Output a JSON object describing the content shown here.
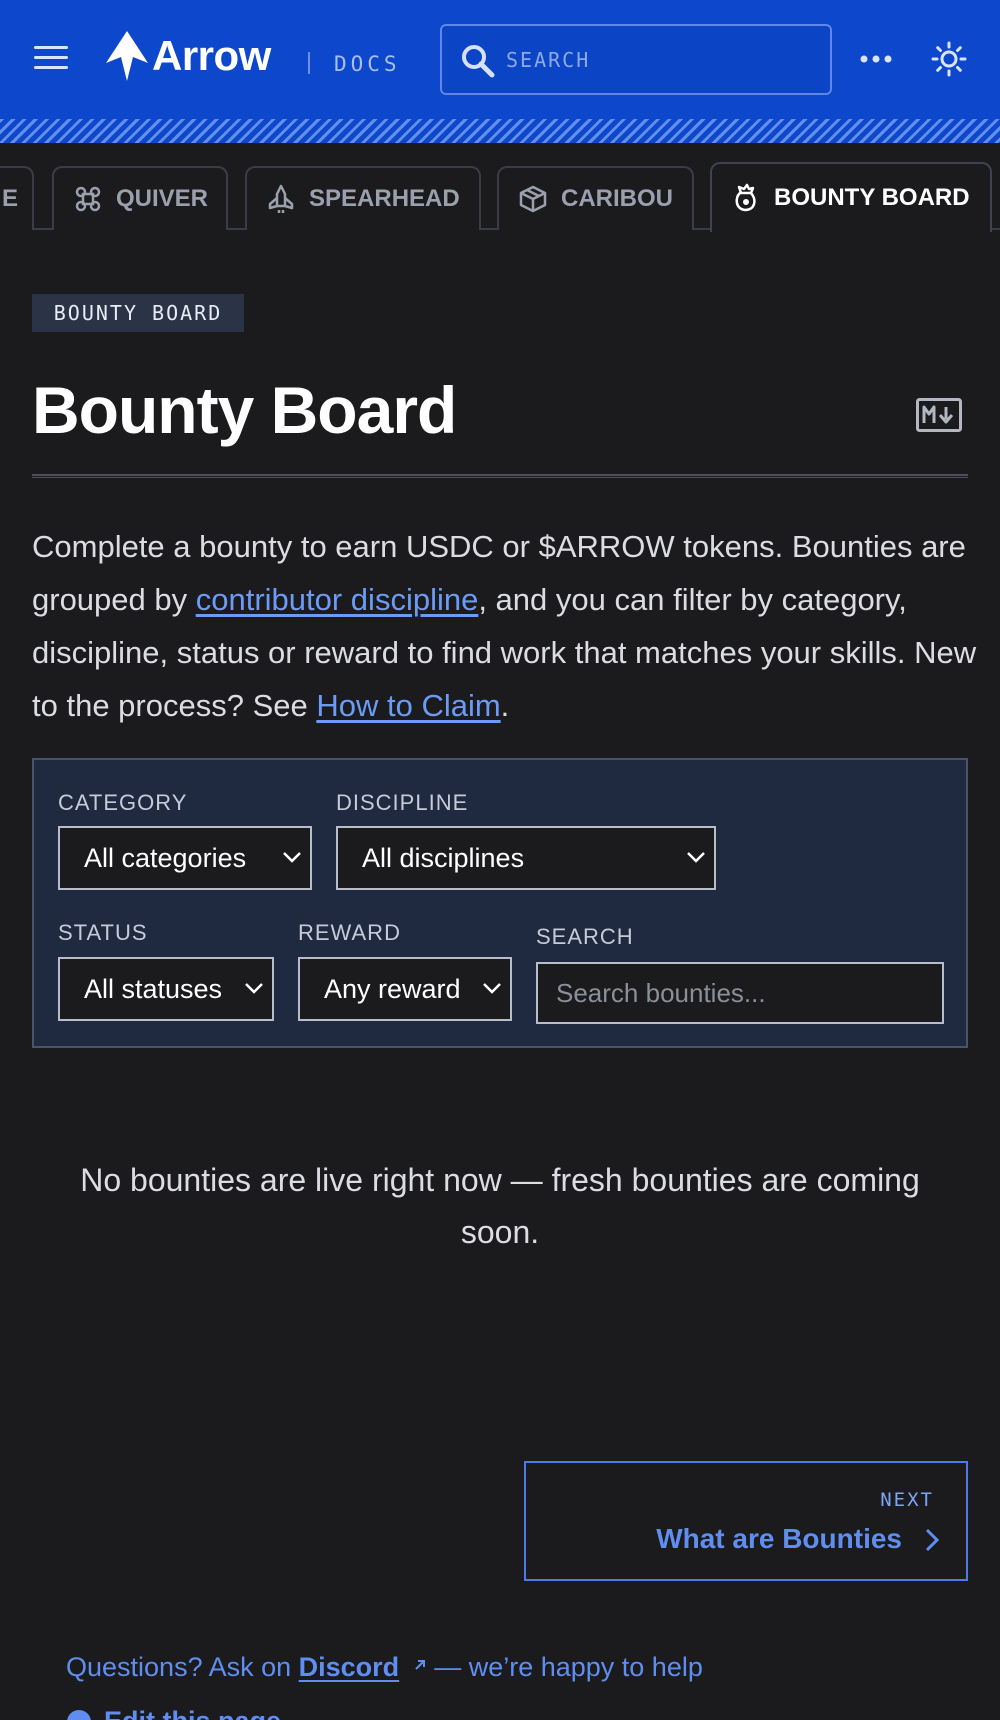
{
  "header": {
    "logo_text": "Arrow",
    "docs_label": "DOCS",
    "search_label": "SEARCH"
  },
  "tabs": [
    {
      "label": "E",
      "icon": "partial-tab"
    },
    {
      "label": "QUIVER",
      "icon": "quiver-icon"
    },
    {
      "label": "SPEARHEAD",
      "icon": "spearhead-icon"
    },
    {
      "label": "CARIBOU",
      "icon": "cube-icon"
    },
    {
      "label": "BOUNTY BOARD",
      "icon": "bounty-icon",
      "active": true
    }
  ],
  "page": {
    "badge": "BOUNTY BOARD",
    "title": "Bounty Board",
    "intro_1": "Complete a bounty to earn USDC or $ARROW tokens. Bounties are grouped by ",
    "intro_link_1": "contributor discipline",
    "intro_2": ", and you can filter by category, discipline, status or reward to find work that matches your skills. New to the process? See ",
    "intro_link_2": "How to Claim",
    "intro_3": "."
  },
  "filters": {
    "category_label": "CATEGORY",
    "category_value": "All categories",
    "discipline_label": "DISCIPLINE",
    "discipline_value": "All disciplines",
    "status_label": "STATUS",
    "status_value": "All statuses",
    "reward_label": "REWARD",
    "reward_value": "Any reward",
    "search_label": "SEARCH",
    "search_placeholder": "Search bounties..."
  },
  "empty_state": "No bounties are live right now — fresh bounties are coming soon.",
  "pagination": {
    "next_label": "NEXT",
    "next_title": "What are Bounties"
  },
  "footer": {
    "question_prefix": "Questions? Ask on ",
    "discord_link": "Discord",
    "question_suffix": " — we’re happy to help",
    "edit_label": "Edit this page"
  },
  "colors": {
    "header_bg": "#0d48cc",
    "page_bg": "#1b1b1d",
    "link": "#6b9bf5",
    "filter_panel_bg": "#1f2a40"
  }
}
